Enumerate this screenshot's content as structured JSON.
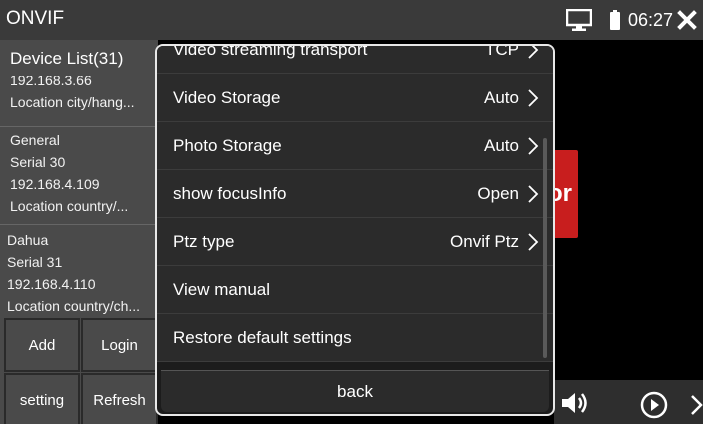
{
  "app": {
    "title": "ONVIF",
    "clock": "06:27"
  },
  "device_list": {
    "title": "Device List(31)",
    "items": [
      {
        "lines": [
          "192.168.3.66",
          "Location city/hang..."
        ]
      },
      {
        "lines": [
          "General",
          "Serial 30",
          "192.168.4.109",
          "Location country/..."
        ]
      },
      {
        "lines": [
          "Dahua",
          "Serial 31",
          "192.168.4.110",
          "Location country/ch..."
        ]
      }
    ]
  },
  "buttons": {
    "add": "Add",
    "login": "Login",
    "setting": "setting",
    "refresh": "Refresh"
  },
  "background": {
    "red_label": "or"
  },
  "dialog": {
    "items": [
      {
        "label": "Video streaming transport",
        "value": "TCP"
      },
      {
        "label": "Video Storage",
        "value": "Auto"
      },
      {
        "label": "Photo Storage",
        "value": "Auto"
      },
      {
        "label": "show focusInfo",
        "value": "Open"
      },
      {
        "label": "Ptz type",
        "value": "Onvif Ptz"
      },
      {
        "label": "View manual",
        "value": ""
      },
      {
        "label": "Restore default settings",
        "value": ""
      }
    ],
    "back": "back"
  },
  "colors": {
    "accent_red": "#c81e1e",
    "titlebar": "#3a3a3a",
    "panel": "#4a4a4a"
  },
  "icons": [
    "monitor-icon",
    "battery-icon",
    "close-icon",
    "chevron-right-icon",
    "speaker-icon",
    "play-icon",
    "next-icon"
  ]
}
